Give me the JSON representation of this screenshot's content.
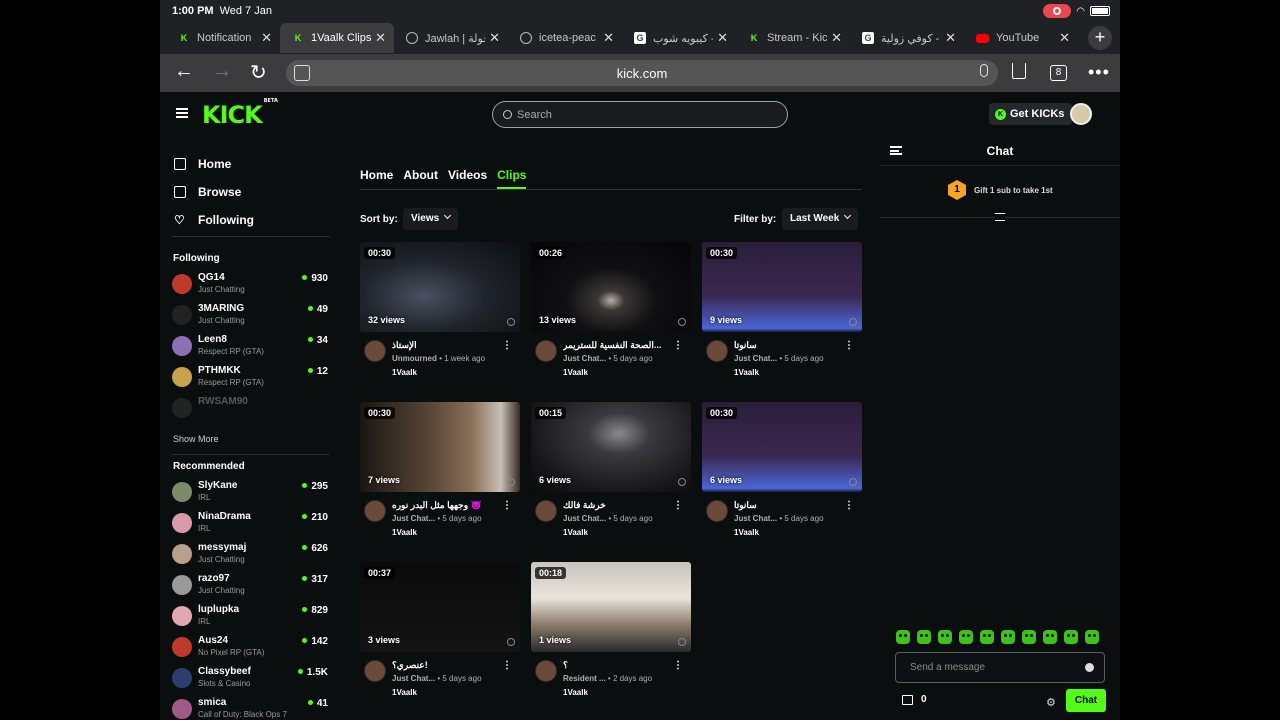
{
  "status": {
    "time": "1:00 PM",
    "date": "Wed 7 Jan"
  },
  "tabs": [
    {
      "title": "Notification",
      "icon": "kick"
    },
    {
      "title": "1Vaalk Clips",
      "icon": "kick",
      "active": true
    },
    {
      "title": "Jawlah | جولة",
      "icon": "globe"
    },
    {
      "title": "icetea-peac",
      "icon": "globe"
    },
    {
      "title": "كيبويه شوب -",
      "icon": "google"
    },
    {
      "title": "Stream - Kic",
      "icon": "kick"
    },
    {
      "title": "كوفي زولية - ..",
      "icon": "google"
    },
    {
      "title": "YouTube",
      "icon": "youtube"
    }
  ],
  "browser": {
    "url": "kick.com",
    "tab_count": "8"
  },
  "header": {
    "logo": "KICK",
    "logo_badge": "BETA",
    "search_placeholder": "Search",
    "get_kicks": "Get KICKs"
  },
  "sidebar": {
    "nav": {
      "home": "Home",
      "browse": "Browse",
      "following": "Following"
    },
    "following_title": "Following",
    "following": [
      {
        "name": "QG14",
        "category": "Just Chatting",
        "viewers": "930",
        "color": "#c0392b"
      },
      {
        "name": "3MARING",
        "category": "Just Chatting",
        "viewers": "49",
        "color": "#222"
      },
      {
        "name": "Leen8",
        "category": "Respect RP (GTA)",
        "viewers": "34",
        "color": "#8e6fb5"
      },
      {
        "name": "PTHMKK",
        "category": "Respect RP (GTA)",
        "viewers": "12",
        "color": "#c8a24a"
      },
      {
        "name": "RWSAM90",
        "category": "",
        "viewers": "",
        "color": "#555"
      }
    ],
    "show_more": "Show More",
    "recommended_title": "Recommended",
    "recommended": [
      {
        "name": "SlyKane",
        "category": "IRL",
        "viewers": "295",
        "color": "#7a8a6a"
      },
      {
        "name": "NinaDrama",
        "category": "IRL",
        "viewers": "210",
        "color": "#d89aa8"
      },
      {
        "name": "messymaj",
        "category": "Just Chatting",
        "viewers": "626",
        "color": "#b8a08a"
      },
      {
        "name": "razo97",
        "category": "Just Chatting",
        "viewers": "317",
        "color": "#9a9a9a"
      },
      {
        "name": "luplupka",
        "category": "IRL",
        "viewers": "829",
        "color": "#e0a8b0"
      },
      {
        "name": "Aus24",
        "category": "No Pixel RP (GTA)",
        "viewers": "142",
        "color": "#c0392b"
      },
      {
        "name": "Classybeef",
        "category": "Slots & Casino",
        "viewers": "1.5K",
        "color": "#2c3e70"
      },
      {
        "name": "smica",
        "category": "Call of Duty: Black Ops 7",
        "viewers": "41",
        "color": "#a05a8a"
      }
    ]
  },
  "main": {
    "tabs": [
      "Home",
      "About",
      "Videos",
      "Clips"
    ],
    "active_tab": "Clips",
    "sort_label": "Sort by:",
    "sort_value": "Views",
    "filter_label": "Filter by:",
    "filter_value": "Last Week",
    "clips": [
      {
        "duration": "00:30",
        "views": "32 views",
        "title": "الإستاذ",
        "category": "Unmourned",
        "age": "1 week ago",
        "user": "1Vaalk",
        "thumb": "dark-room"
      },
      {
        "duration": "00:26",
        "views": "13 views",
        "title": "الصحة النفسية للستريمر...",
        "category": "Just Chat...",
        "age": "5 days ago",
        "user": "1Vaalk",
        "thumb": "dark-light"
      },
      {
        "duration": "00:30",
        "views": "9 views",
        "title": "سانوتا",
        "category": "Just Chat...",
        "age": "5 days ago",
        "user": "1Vaalk",
        "thumb": "screen"
      },
      {
        "duration": "00:30",
        "views": "7 views",
        "title": "وجهها مثل البدر نوره 😈",
        "category": "Just Chat...",
        "age": "5 days ago",
        "user": "1Vaalk",
        "thumb": "warm-room"
      },
      {
        "duration": "00:15",
        "views": "6 views",
        "title": "خرشة فالك",
        "category": "Just Chat...",
        "age": "5 days ago",
        "user": "1Vaalk",
        "thumb": "grey-room"
      },
      {
        "duration": "00:30",
        "views": "6 views",
        "title": "سانوتا",
        "category": "Just Chat...",
        "age": "5 days ago",
        "user": "1Vaalk",
        "thumb": "screen"
      },
      {
        "duration": "00:37",
        "views": "3 views",
        "title": "عنصري؟!",
        "category": "Just Chat...",
        "age": "5 days ago",
        "user": "1Vaalk",
        "thumb": "black"
      },
      {
        "duration": "00:18",
        "views": "1 views",
        "title": "؟",
        "category": "Resident ...",
        "age": "2 days ago",
        "user": "1Vaalk",
        "thumb": "person"
      }
    ]
  },
  "chat": {
    "title": "Chat",
    "gift_badge": "1",
    "gift_text": "Gift 1 sub to take 1st",
    "placeholder": "Send a message",
    "points": "0",
    "send_label": "Chat"
  },
  "colors": {
    "brand": "#53fc18",
    "background": "#0b0e0f"
  }
}
